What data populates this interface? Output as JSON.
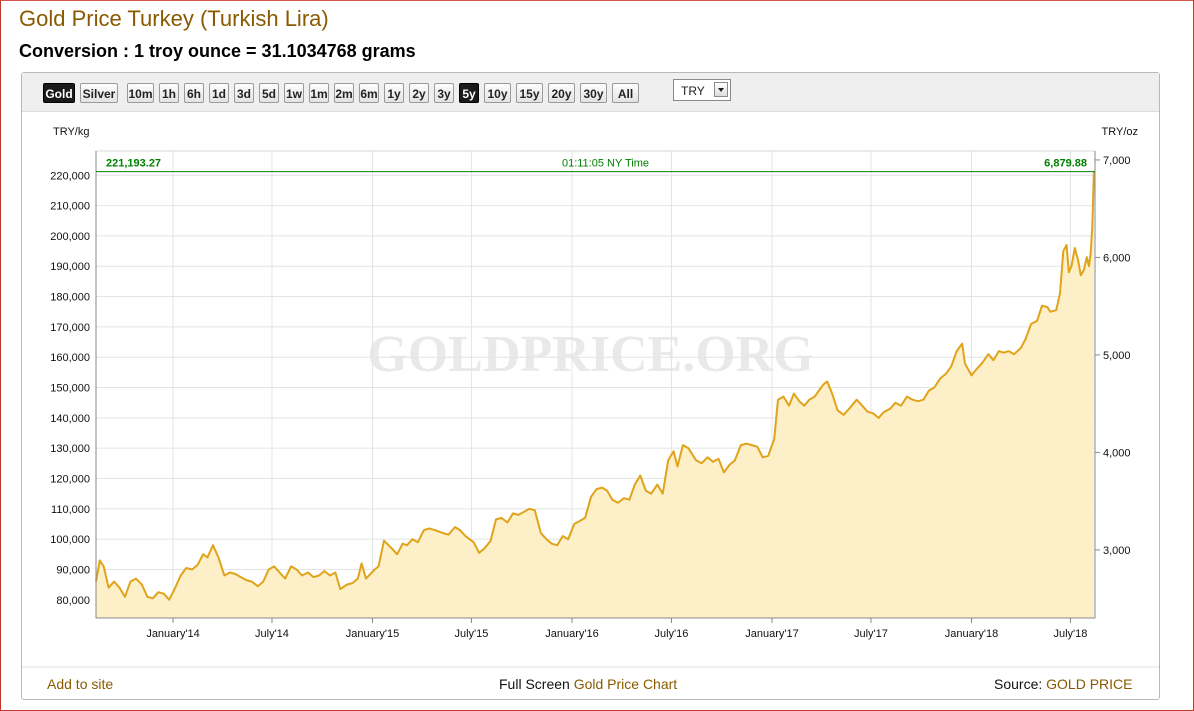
{
  "header": {
    "title": "Gold Price Turkey (Turkish Lira)",
    "conversion": "Conversion : 1 troy ounce = 31.1034768 grams"
  },
  "toolbar": {
    "metals": [
      {
        "label": "Gold",
        "active": true
      },
      {
        "label": "Silver",
        "active": false
      }
    ],
    "ranges": [
      {
        "label": "10m",
        "active": false
      },
      {
        "label": "1h",
        "active": false
      },
      {
        "label": "6h",
        "active": false
      },
      {
        "label": "1d",
        "active": false
      },
      {
        "label": "3d",
        "active": false
      },
      {
        "label": "5d",
        "active": false
      },
      {
        "label": "1w",
        "active": false
      },
      {
        "label": "1m",
        "active": false
      },
      {
        "label": "2m",
        "active": false
      },
      {
        "label": "6m",
        "active": false
      },
      {
        "label": "1y",
        "active": false
      },
      {
        "label": "2y",
        "active": false
      },
      {
        "label": "3y",
        "active": false
      },
      {
        "label": "5y",
        "active": true
      },
      {
        "label": "10y",
        "active": false
      },
      {
        "label": "15y",
        "active": false
      },
      {
        "label": "20y",
        "active": false
      },
      {
        "label": "30y",
        "active": false
      },
      {
        "label": "All",
        "active": false
      }
    ],
    "currency": "TRY"
  },
  "chart_data": {
    "type": "area",
    "left_unit": "TRY/kg",
    "right_unit": "TRY/oz",
    "watermark": "GOLDPRICE.ORG",
    "current_left_value": "221,193.27",
    "current_right_value": "6,879.88",
    "current_time": "01:11:05 NY Time",
    "current_value": 221193.27,
    "left_ticks": [
      80000,
      90000,
      100000,
      110000,
      120000,
      130000,
      140000,
      150000,
      160000,
      170000,
      180000,
      190000,
      200000,
      210000,
      220000
    ],
    "right_ticks": [
      3000,
      4000,
      5000,
      6000,
      7000
    ],
    "x_tick_labels": [
      "January'14",
      "July'14",
      "January'15",
      "July'15",
      "January'16",
      "July'16",
      "January'17",
      "July'17",
      "January'18",
      "July'18"
    ],
    "ylim_left": [
      74000,
      228000
    ],
    "x_range": [
      "2013-08",
      "2018-08"
    ],
    "grid": true,
    "colors": {
      "line": "#e0a31a",
      "fill": "#fdefc8",
      "current": "#008000",
      "text_brown": "#8a5a00"
    },
    "series": [
      {
        "values": [
          [
            "2013-08-13",
            86000
          ],
          [
            "2013-08-20",
            93000
          ],
          [
            "2013-08-27",
            91000
          ],
          [
            "2013-09-05",
            84000
          ],
          [
            "2013-09-15",
            86000
          ],
          [
            "2013-09-25",
            84000
          ],
          [
            "2013-10-05",
            81000
          ],
          [
            "2013-10-15",
            86000
          ],
          [
            "2013-10-25",
            87000
          ],
          [
            "2013-11-05",
            85000
          ],
          [
            "2013-11-15",
            81000
          ],
          [
            "2013-11-25",
            80500
          ],
          [
            "2013-12-05",
            82500
          ],
          [
            "2013-12-15",
            82000
          ],
          [
            "2013-12-25",
            80000
          ],
          [
            "2014-01-05",
            84000
          ],
          [
            "2014-01-15",
            88000
          ],
          [
            "2014-01-25",
            90500
          ],
          [
            "2014-02-05",
            90000
          ],
          [
            "2014-02-15",
            91500
          ],
          [
            "2014-02-25",
            95000
          ],
          [
            "2014-03-05",
            94000
          ],
          [
            "2014-03-15",
            98000
          ],
          [
            "2014-03-25",
            94000
          ],
          [
            "2014-04-05",
            88000
          ],
          [
            "2014-04-15",
            89000
          ],
          [
            "2014-04-25",
            88500
          ],
          [
            "2014-05-05",
            87500
          ],
          [
            "2014-05-15",
            86500
          ],
          [
            "2014-05-25",
            86000
          ],
          [
            "2014-06-05",
            84500
          ],
          [
            "2014-06-15",
            86000
          ],
          [
            "2014-06-25",
            90000
          ],
          [
            "2014-07-05",
            91000
          ],
          [
            "2014-07-15",
            89000
          ],
          [
            "2014-07-25",
            87000
          ],
          [
            "2014-08-05",
            91000
          ],
          [
            "2014-08-15",
            90000
          ],
          [
            "2014-08-25",
            88000
          ],
          [
            "2014-09-05",
            89000
          ],
          [
            "2014-09-15",
            87500
          ],
          [
            "2014-09-25",
            88000
          ],
          [
            "2014-10-05",
            89500
          ],
          [
            "2014-10-15",
            88000
          ],
          [
            "2014-10-25",
            89000
          ],
          [
            "2014-11-03",
            83500
          ],
          [
            "2014-11-15",
            85000
          ],
          [
            "2014-11-25",
            85500
          ],
          [
            "2014-12-05",
            87000
          ],
          [
            "2014-12-12",
            92000
          ],
          [
            "2014-12-20",
            87000
          ],
          [
            "2015-01-05",
            90000
          ],
          [
            "2015-01-12",
            91000
          ],
          [
            "2015-01-22",
            99500
          ],
          [
            "2015-02-05",
            97000
          ],
          [
            "2015-02-15",
            95000
          ],
          [
            "2015-02-25",
            98500
          ],
          [
            "2015-03-05",
            98000
          ],
          [
            "2015-03-15",
            100000
          ],
          [
            "2015-03-25",
            99000
          ],
          [
            "2015-04-05",
            103000
          ],
          [
            "2015-04-15",
            103500
          ],
          [
            "2015-04-25",
            103000
          ],
          [
            "2015-05-10",
            102000
          ],
          [
            "2015-05-20",
            101500
          ],
          [
            "2015-06-01",
            104000
          ],
          [
            "2015-06-10",
            103000
          ],
          [
            "2015-06-20",
            101000
          ],
          [
            "2015-07-05",
            99000
          ],
          [
            "2015-07-15",
            95500
          ],
          [
            "2015-07-25",
            97000
          ],
          [
            "2015-08-05",
            99500
          ],
          [
            "2015-08-15",
            106500
          ],
          [
            "2015-08-25",
            107000
          ],
          [
            "2015-09-05",
            105500
          ],
          [
            "2015-09-15",
            108500
          ],
          [
            "2015-09-25",
            108000
          ],
          [
            "2015-10-05",
            109000
          ],
          [
            "2015-10-15",
            110000
          ],
          [
            "2015-10-25",
            109500
          ],
          [
            "2015-11-05",
            102000
          ],
          [
            "2015-11-15",
            100000
          ],
          [
            "2015-11-25",
            98500
          ],
          [
            "2015-12-05",
            98000
          ],
          [
            "2015-12-15",
            101000
          ],
          [
            "2015-12-25",
            100000
          ],
          [
            "2016-01-05",
            105000
          ],
          [
            "2016-01-15",
            106000
          ],
          [
            "2016-01-25",
            107000
          ],
          [
            "2016-02-05",
            114000
          ],
          [
            "2016-02-15",
            116500
          ],
          [
            "2016-02-25",
            117000
          ],
          [
            "2016-03-05",
            116000
          ],
          [
            "2016-03-15",
            113000
          ],
          [
            "2016-03-25",
            112000
          ],
          [
            "2016-04-05",
            113500
          ],
          [
            "2016-04-15",
            113000
          ],
          [
            "2016-04-25",
            118000
          ],
          [
            "2016-05-05",
            121000
          ],
          [
            "2016-05-15",
            116000
          ],
          [
            "2016-05-25",
            115000
          ],
          [
            "2016-06-05",
            118000
          ],
          [
            "2016-06-15",
            115000
          ],
          [
            "2016-06-25",
            126000
          ],
          [
            "2016-07-05",
            129000
          ],
          [
            "2016-07-12",
            124000
          ],
          [
            "2016-07-22",
            131000
          ],
          [
            "2016-08-01",
            130000
          ],
          [
            "2016-08-15",
            126000
          ],
          [
            "2016-08-25",
            125000
          ],
          [
            "2016-09-05",
            127000
          ],
          [
            "2016-09-15",
            125500
          ],
          [
            "2016-09-25",
            126500
          ],
          [
            "2016-10-05",
            122000
          ],
          [
            "2016-10-15",
            124500
          ],
          [
            "2016-10-25",
            126000
          ],
          [
            "2016-11-05",
            131000
          ],
          [
            "2016-11-15",
            131500
          ],
          [
            "2016-11-25",
            131000
          ],
          [
            "2016-12-05",
            130500
          ],
          [
            "2016-12-15",
            127000
          ],
          [
            "2016-12-25",
            127500
          ],
          [
            "2017-01-05",
            133000
          ],
          [
            "2017-01-12",
            146000
          ],
          [
            "2017-01-22",
            147000
          ],
          [
            "2017-02-01",
            144000
          ],
          [
            "2017-02-10",
            148000
          ],
          [
            "2017-02-20",
            145500
          ],
          [
            "2017-03-01",
            144000
          ],
          [
            "2017-03-10",
            146000
          ],
          [
            "2017-03-20",
            147000
          ],
          [
            "2017-04-05",
            151000
          ],
          [
            "2017-04-12",
            152000
          ],
          [
            "2017-04-20",
            148500
          ],
          [
            "2017-05-01",
            142500
          ],
          [
            "2017-05-12",
            141000
          ],
          [
            "2017-05-22",
            143000
          ],
          [
            "2017-06-05",
            146000
          ],
          [
            "2017-06-15",
            144000
          ],
          [
            "2017-06-25",
            142000
          ],
          [
            "2017-07-05",
            141500
          ],
          [
            "2017-07-15",
            140000
          ],
          [
            "2017-07-25",
            142000
          ],
          [
            "2017-08-05",
            143000
          ],
          [
            "2017-08-15",
            145000
          ],
          [
            "2017-08-25",
            144000
          ],
          [
            "2017-09-05",
            147000
          ],
          [
            "2017-09-15",
            146000
          ],
          [
            "2017-09-25",
            145500
          ],
          [
            "2017-10-05",
            146000
          ],
          [
            "2017-10-15",
            149000
          ],
          [
            "2017-10-25",
            150000
          ],
          [
            "2017-11-05",
            153000
          ],
          [
            "2017-11-15",
            154500
          ],
          [
            "2017-11-25",
            157000
          ],
          [
            "2017-12-05",
            162000
          ],
          [
            "2017-12-15",
            164500
          ],
          [
            "2017-12-20",
            158000
          ],
          [
            "2018-01-01",
            154000
          ],
          [
            "2018-01-10",
            156000
          ],
          [
            "2018-01-20",
            158000
          ],
          [
            "2018-02-01",
            161000
          ],
          [
            "2018-02-10",
            159000
          ],
          [
            "2018-02-20",
            162000
          ],
          [
            "2018-03-01",
            161500
          ],
          [
            "2018-03-10",
            162000
          ],
          [
            "2018-03-20",
            161000
          ],
          [
            "2018-04-01",
            163000
          ],
          [
            "2018-04-10",
            166000
          ],
          [
            "2018-04-20",
            171000
          ],
          [
            "2018-05-01",
            172000
          ],
          [
            "2018-05-10",
            177000
          ],
          [
            "2018-05-20",
            176500
          ],
          [
            "2018-05-25",
            175000
          ],
          [
            "2018-06-05",
            175500
          ],
          [
            "2018-06-12",
            181000
          ],
          [
            "2018-06-18",
            195000
          ],
          [
            "2018-06-24",
            197000
          ],
          [
            "2018-06-28",
            188000
          ],
          [
            "2018-07-03",
            190000
          ],
          [
            "2018-07-09",
            196000
          ],
          [
            "2018-07-15",
            192000
          ],
          [
            "2018-07-20",
            187000
          ],
          [
            "2018-07-26",
            189000
          ],
          [
            "2018-07-31",
            193000
          ],
          [
            "2018-08-04",
            190000
          ],
          [
            "2018-08-07",
            194000
          ],
          [
            "2018-08-10",
            203000
          ],
          [
            "2018-08-13",
            221193
          ]
        ]
      }
    ]
  },
  "footer": {
    "add_to_site": "Add to site",
    "full_screen_prefix": "Full Screen",
    "full_screen_link": "Gold Price Chart",
    "source_prefix": "Source:",
    "source_link": "GOLD PRICE"
  }
}
